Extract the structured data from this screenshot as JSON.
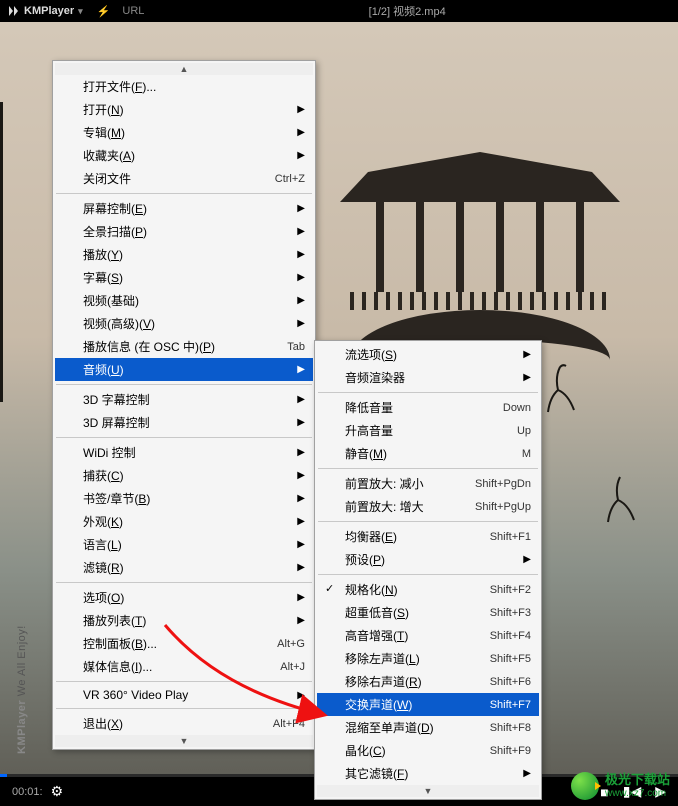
{
  "titlebar": {
    "app_name": "KMPlayer",
    "url_label": "URL",
    "current_file": "[1/2] 视频2.mp4"
  },
  "vertical_brand": {
    "name": "KMPlayer",
    "slogan": "We All Enjoy!"
  },
  "playback": {
    "elapsed": "00:01:",
    "gear": "⚙"
  },
  "menu1": {
    "items": [
      {
        "label_html": "打开文件(<u>F</u>)...",
        "submenu": false
      },
      {
        "label_html": "打开(<u>N</u>)",
        "submenu": true
      },
      {
        "label_html": "专辑(<u>M</u>)",
        "submenu": true
      },
      {
        "label_html": "收藏夹(<u>A</u>)",
        "submenu": true
      },
      {
        "label_html": "关闭文件",
        "shortcut": "Ctrl+Z"
      },
      {
        "sep": true
      },
      {
        "label_html": "屏幕控制(<u>E</u>)",
        "submenu": true
      },
      {
        "label_html": "全景扫描(<u>P</u>)",
        "submenu": true
      },
      {
        "label_html": "播放(<u>Y</u>)",
        "submenu": true
      },
      {
        "label_html": "字幕(<u>S</u>)",
        "submenu": true
      },
      {
        "label_html": "视频(基础)",
        "submenu": true
      },
      {
        "label_html": "视频(高级)(<u>V</u>)",
        "submenu": true
      },
      {
        "label_html": "播放信息 (在 OSC 中)(<u>P</u>)",
        "shortcut": "Tab"
      },
      {
        "label_html": "音频(<u>U</u>)",
        "submenu": true,
        "highlight": true
      },
      {
        "sep": true
      },
      {
        "label_html": "3D 字幕控制",
        "submenu": true
      },
      {
        "label_html": "3D 屏幕控制",
        "submenu": true
      },
      {
        "sep": true
      },
      {
        "label_html": "WiDi 控制",
        "submenu": true
      },
      {
        "label_html": "捕获(<u>C</u>)",
        "submenu": true
      },
      {
        "label_html": "书签/章节(<u>B</u>)",
        "submenu": true
      },
      {
        "label_html": "外观(<u>K</u>)",
        "submenu": true
      },
      {
        "label_html": "语言(<u>L</u>)",
        "submenu": true
      },
      {
        "label_html": "滤镜(<u>R</u>)",
        "submenu": true
      },
      {
        "sep": true
      },
      {
        "label_html": "选项(<u>O</u>)",
        "submenu": true
      },
      {
        "label_html": "播放列表(<u>T</u>)",
        "submenu": true
      },
      {
        "label_html": "控制面板(<u>B</u>)...",
        "shortcut": "Alt+G"
      },
      {
        "label_html": "媒体信息(<u>I</u>)...",
        "shortcut": "Alt+J"
      },
      {
        "sep": true
      },
      {
        "label_html": "VR 360° Video Play",
        "submenu": true
      },
      {
        "sep": true
      },
      {
        "label_html": "退出(<u>X</u>)",
        "shortcut": "Alt+F4"
      }
    ]
  },
  "menu2": {
    "items": [
      {
        "label_html": "流选项(<u>S</u>)",
        "submenu": true
      },
      {
        "label_html": "音频渲染器",
        "submenu": true
      },
      {
        "sep": true
      },
      {
        "label_html": "降低音量",
        "shortcut": "Down"
      },
      {
        "label_html": "升高音量",
        "shortcut": "Up"
      },
      {
        "label_html": "静音(<u>M</u>)",
        "shortcut": "M"
      },
      {
        "sep": true
      },
      {
        "label_html": "前置放大: 减小",
        "shortcut": "Shift+PgDn"
      },
      {
        "label_html": "前置放大: 增大",
        "shortcut": "Shift+PgUp"
      },
      {
        "sep": true
      },
      {
        "label_html": "均衡器(<u>E</u>)",
        "shortcut": "Shift+F1"
      },
      {
        "label_html": "预设(<u>P</u>)",
        "submenu": true
      },
      {
        "sep": true
      },
      {
        "label_html": "规格化(<u>N</u>)",
        "shortcut": "Shift+F2",
        "check": true
      },
      {
        "label_html": "超重低音(<u>S</u>)",
        "shortcut": "Shift+F3"
      },
      {
        "label_html": "高音增强(<u>T</u>)",
        "shortcut": "Shift+F4"
      },
      {
        "label_html": "移除左声道(<u>L</u>)",
        "shortcut": "Shift+F5"
      },
      {
        "label_html": "移除右声道(<u>R</u>)",
        "shortcut": "Shift+F6"
      },
      {
        "label_html": "交换声道(<u>W</u>)",
        "shortcut": "Shift+F7",
        "highlight": true
      },
      {
        "label_html": "混缩至单声道(<u>D</u>)",
        "shortcut": "Shift+F8"
      },
      {
        "label_html": "晶化(<u>C</u>)",
        "shortcut": "Shift+F9"
      },
      {
        "label_html": "其它滤镜(<u>F</u>)",
        "submenu": true
      }
    ]
  },
  "watermark": {
    "cn": "极光下载站",
    "en": "www.xz7.com"
  }
}
